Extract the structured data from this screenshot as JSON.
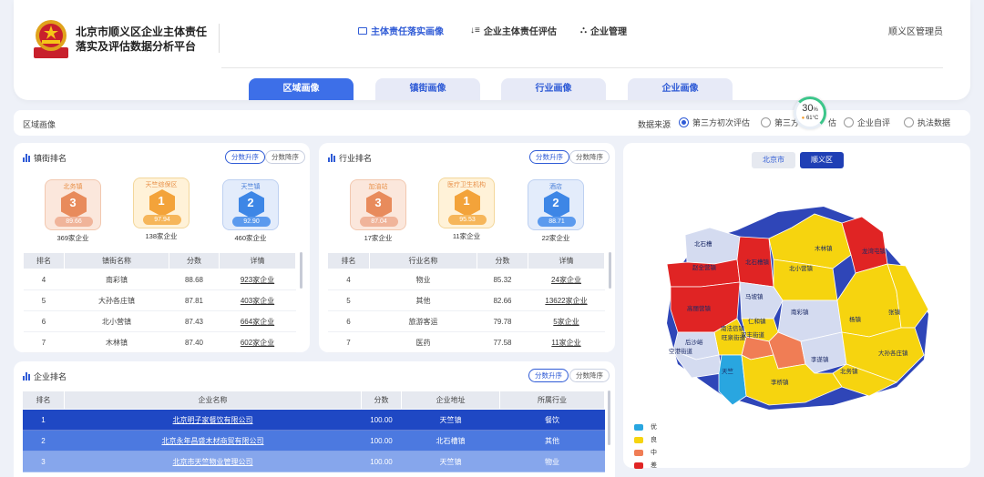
{
  "header": {
    "title_line1": "北京市顺义区企业主体责任",
    "title_line2": "落实及评估数据分析平台",
    "nav": [
      {
        "label": "主体责任落实画像",
        "icon": "id-card-icon",
        "active": true
      },
      {
        "label": "企业主体责任评估",
        "icon": "sort-icon",
        "active": false
      },
      {
        "label": "企业管理",
        "icon": "hierarchy-icon",
        "active": false
      }
    ],
    "admin": "顺义区管理员"
  },
  "tabs": [
    {
      "label": "区域画像",
      "active": true
    },
    {
      "label": "镇街画像",
      "active": false
    },
    {
      "label": "行业画像",
      "active": false
    },
    {
      "label": "企业画像",
      "active": false
    }
  ],
  "filter": {
    "section_label": "区域画像",
    "source_label": "数据来源",
    "options": [
      {
        "label": "第三方初次评估",
        "selected": true
      },
      {
        "label": "第三方",
        "suffix": "估",
        "selected": false
      },
      {
        "label": "企业自评",
        "selected": false
      },
      {
        "label": "执法数据",
        "selected": false
      }
    ]
  },
  "gauge": {
    "percent": "30",
    "unit": "%",
    "temp": "61°C",
    "value": 0.3
  },
  "town_ranking": {
    "title": "镇街排名",
    "sort_asc": "分数升序",
    "sort_desc": "分数降序",
    "podium": [
      {
        "rank": "3",
        "name": "北务镇",
        "score": "89.66",
        "count": "369家企业",
        "tier": "bronze"
      },
      {
        "rank": "1",
        "name": "天竺综保区",
        "score": "97.94",
        "count": "138家企业",
        "tier": "gold"
      },
      {
        "rank": "2",
        "name": "天竺镇",
        "score": "92.90",
        "count": "460家企业",
        "tier": "silver"
      }
    ],
    "columns": [
      "排名",
      "镇街名称",
      "分数",
      "详情"
    ],
    "rows": [
      {
        "rank": "4",
        "name": "南彩镇",
        "score": "88.68",
        "detail": "923家企业"
      },
      {
        "rank": "5",
        "name": "大孙各庄镇",
        "score": "87.81",
        "detail": "403家企业"
      },
      {
        "rank": "6",
        "name": "北小营镇",
        "score": "87.43",
        "detail": "664家企业"
      },
      {
        "rank": "7",
        "name": "木林镇",
        "score": "87.40",
        "detail": "602家企业"
      }
    ]
  },
  "industry_ranking": {
    "title": "行业排名",
    "sort_asc": "分数升序",
    "sort_desc": "分数降序",
    "podium": [
      {
        "rank": "3",
        "name": "加油站",
        "score": "87.04",
        "count": "17家企业",
        "tier": "bronze"
      },
      {
        "rank": "1",
        "name": "医疗卫生机构",
        "score": "95.53",
        "count": "11家企业",
        "tier": "gold"
      },
      {
        "rank": "2",
        "name": "酒店",
        "score": "88.71",
        "count": "22家企业",
        "tier": "silver"
      }
    ],
    "columns": [
      "排名",
      "行业名称",
      "分数",
      "详情"
    ],
    "rows": [
      {
        "rank": "4",
        "name": "物业",
        "score": "85.32",
        "detail": "24家企业"
      },
      {
        "rank": "5",
        "name": "其他",
        "score": "82.66",
        "detail": "13622家企业"
      },
      {
        "rank": "6",
        "name": "旅游客运",
        "score": "79.78",
        "detail": "5家企业"
      },
      {
        "rank": "7",
        "name": "医药",
        "score": "77.58",
        "detail": "11家企业"
      }
    ]
  },
  "enterprise_ranking": {
    "title": "企业排名",
    "sort_asc": "分数升序",
    "sort_desc": "分数降序",
    "columns": [
      "排名",
      "企业名称",
      "分数",
      "企业地址",
      "所属行业"
    ],
    "rows": [
      {
        "rank": "1",
        "name": "北京明子家餐饮有限公司",
        "score": "100.00",
        "address": "天竺镇",
        "industry": "餐饮"
      },
      {
        "rank": "2",
        "name": "北京永年昌盛木材商贸有限公司",
        "score": "100.00",
        "address": "北石槽镇",
        "industry": "其他"
      },
      {
        "rank": "3",
        "name": "北京市天竺物业管理公司",
        "score": "100.00",
        "address": "天竺镇",
        "industry": "物业"
      }
    ]
  },
  "map": {
    "btn_city": "北京市",
    "btn_district": "顺义区",
    "colors": {
      "excellent": "#29a6e0",
      "good": "#f6d40f",
      "medium": "#f07d55",
      "poor": "#e02424",
      "outline": "#2f46b8"
    },
    "legend": [
      {
        "label": "优",
        "color": "#29a6e0"
      },
      {
        "label": "良",
        "color": "#f6d40f"
      },
      {
        "label": "中",
        "color": "#f07d55"
      },
      {
        "label": "差",
        "color": "#e02424"
      }
    ],
    "labels": {
      "a": "北石槽",
      "b": "赵全营镇",
      "c": "北石槽镇",
      "d": "木林镇",
      "e": "龙湾屯镇",
      "f": "北小营镇",
      "g": "高丽营镇",
      "h": "马坡镇",
      "i": "南彩镇",
      "j": "杨镇",
      "k": "张镇",
      "l": "仁和镇",
      "m": "南法信镇",
      "n": "旺泉街道",
      "o": "双丰街道",
      "p": "李遂镇",
      "q": "大孙各庄镇",
      "r": "后沙峪",
      "s": "空港街道",
      "t": "北务镇",
      "u": "天竺",
      "v": "李桥镇"
    }
  }
}
